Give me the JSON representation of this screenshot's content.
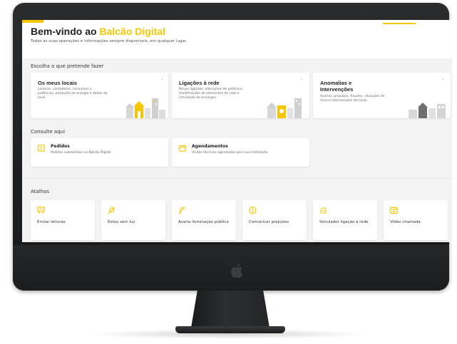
{
  "header": {
    "title_prefix": "Bem-vindo ao ",
    "title_highlight": "Balcão Digital",
    "subtitle": "Todas as suas operações e informações sempre disponíveis, em qualquer lugar."
  },
  "sections": {
    "choose": "Escolha o que pretende fazer",
    "consult": "Consulte aqui",
    "shortcuts": "Atalhos"
  },
  "main_cards": [
    {
      "title": "Os meus locais",
      "description": "Leituras, contadores, consumos e potências, produção de energia e dados do local.",
      "arrow": "›"
    },
    {
      "title": "Ligações à rede",
      "description": "Novas ligações, alterações de potência, modificações de elementos de rede e simulação de encargos.",
      "arrow": "›"
    },
    {
      "title": "Anomalias e Intervenções",
      "description": "Avarias, prejuízos, fraudes, situações de risco e intervenções técnicas.",
      "arrow": "›"
    }
  ],
  "consult_cards": [
    {
      "title": "Pedidos",
      "description": "Pedidos submetidos no Balcão Digital",
      "icon": "document-icon"
    },
    {
      "title": "Agendamentos",
      "description": "Visitas técnicas agendadas para sua instalação",
      "icon": "calendar-icon"
    }
  ],
  "shortcuts": [
    {
      "label": "Enviar leituras",
      "icon": "meter-icon"
    },
    {
      "label": "Estou sem luz",
      "icon": "no-light-icon"
    },
    {
      "label": "Avaria iluminação pública",
      "icon": "streetlight-fault-icon"
    },
    {
      "label": "Comunicar prejuízos",
      "icon": "coin-icon"
    },
    {
      "label": "Simulador ligação à rede",
      "icon": "plug-icon"
    },
    {
      "label": "Vídeo chamada",
      "icon": "video-call-icon"
    }
  ],
  "colors": {
    "accent": "#f6c700",
    "background": "#f3f3f3",
    "card": "#ffffff",
    "device": "#1d1e20"
  }
}
